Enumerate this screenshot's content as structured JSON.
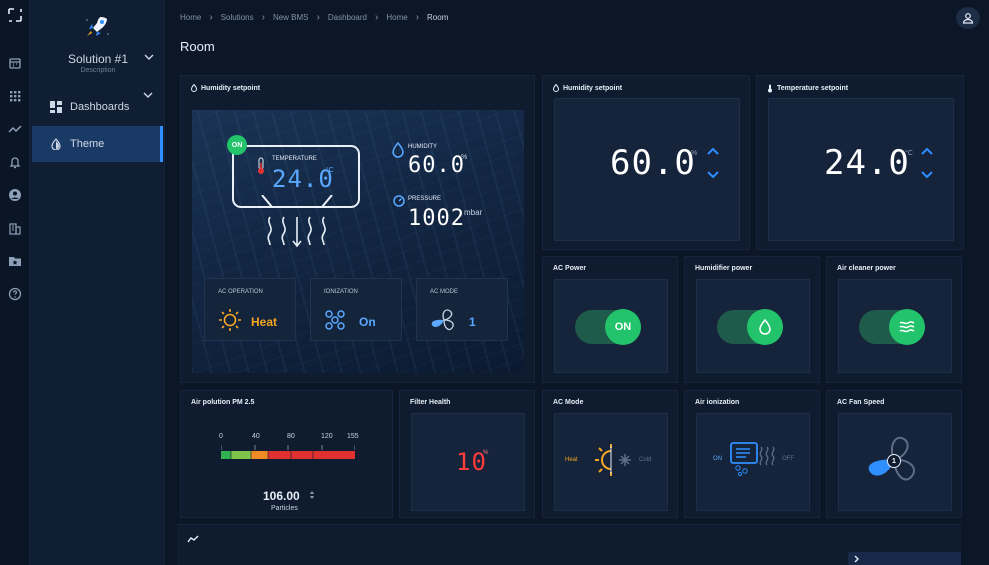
{
  "breadcrumb": [
    "Home",
    "Solutions",
    "New BMS",
    "Dashboard",
    "Home",
    "Room"
  ],
  "page_title": "Room",
  "solution": {
    "name": "Solution #1",
    "description": "Description"
  },
  "nav": {
    "dashboards": "Dashboards",
    "theme": "Theme"
  },
  "rail_icons": [
    "logo-icon",
    "calendar-icon",
    "apps-grid-icon",
    "analytics-icon",
    "alarm-bell-icon",
    "user-circle-icon",
    "building-icon",
    "folder-star-icon",
    "help-circle-icon"
  ],
  "hero": {
    "title": "Humidity setpoint",
    "on_badge": "ON",
    "temperature_label": "TEMPERATURE",
    "temperature_value": "24.0",
    "temperature_unit": "°C",
    "humidity_label": "HUMIDITY",
    "humidity_value": "60.0",
    "humidity_unit": "%",
    "pressure_label": "PRESSURE",
    "pressure_value": "1002",
    "pressure_unit": "mbar",
    "cards": [
      {
        "label": "AC OPERATION",
        "value": "Heat"
      },
      {
        "label": "IONIZATION",
        "value": "On"
      },
      {
        "label": "AC MODE",
        "value": "1"
      }
    ]
  },
  "humidity_setpoint": {
    "title": "Humidity setpoint",
    "value": "60.0",
    "unit": "%"
  },
  "temperature_setpoint": {
    "title": "Temperature setpoint",
    "value": "24.0",
    "unit": "°C"
  },
  "power_widgets": [
    {
      "title": "AC Power",
      "knob": "ON"
    },
    {
      "title": "Humidifier power",
      "knob": ""
    },
    {
      "title": "Air cleaner power",
      "knob": ""
    }
  ],
  "pm25": {
    "title": "Air polution PM 2.5",
    "scale": [
      "0",
      "40",
      "80",
      "120",
      "155"
    ],
    "value": "106.00",
    "unit": "Particles",
    "fraction": 0.684
  },
  "filter_health": {
    "title": "Filter Health",
    "value": "10",
    "unit": "%"
  },
  "ac_mode": {
    "title": "AC Mode",
    "heat": "Heat",
    "cold": "Cold"
  },
  "air_ionization": {
    "title": "Air ionization",
    "on": "ON",
    "off": "OFF"
  },
  "fan_speed": {
    "title": "AC Fan Speed",
    "value": "1"
  },
  "colors": {
    "accent": "#2f8fff",
    "green": "#22c36a",
    "orange": "#f5a623",
    "red": "#e03131"
  }
}
